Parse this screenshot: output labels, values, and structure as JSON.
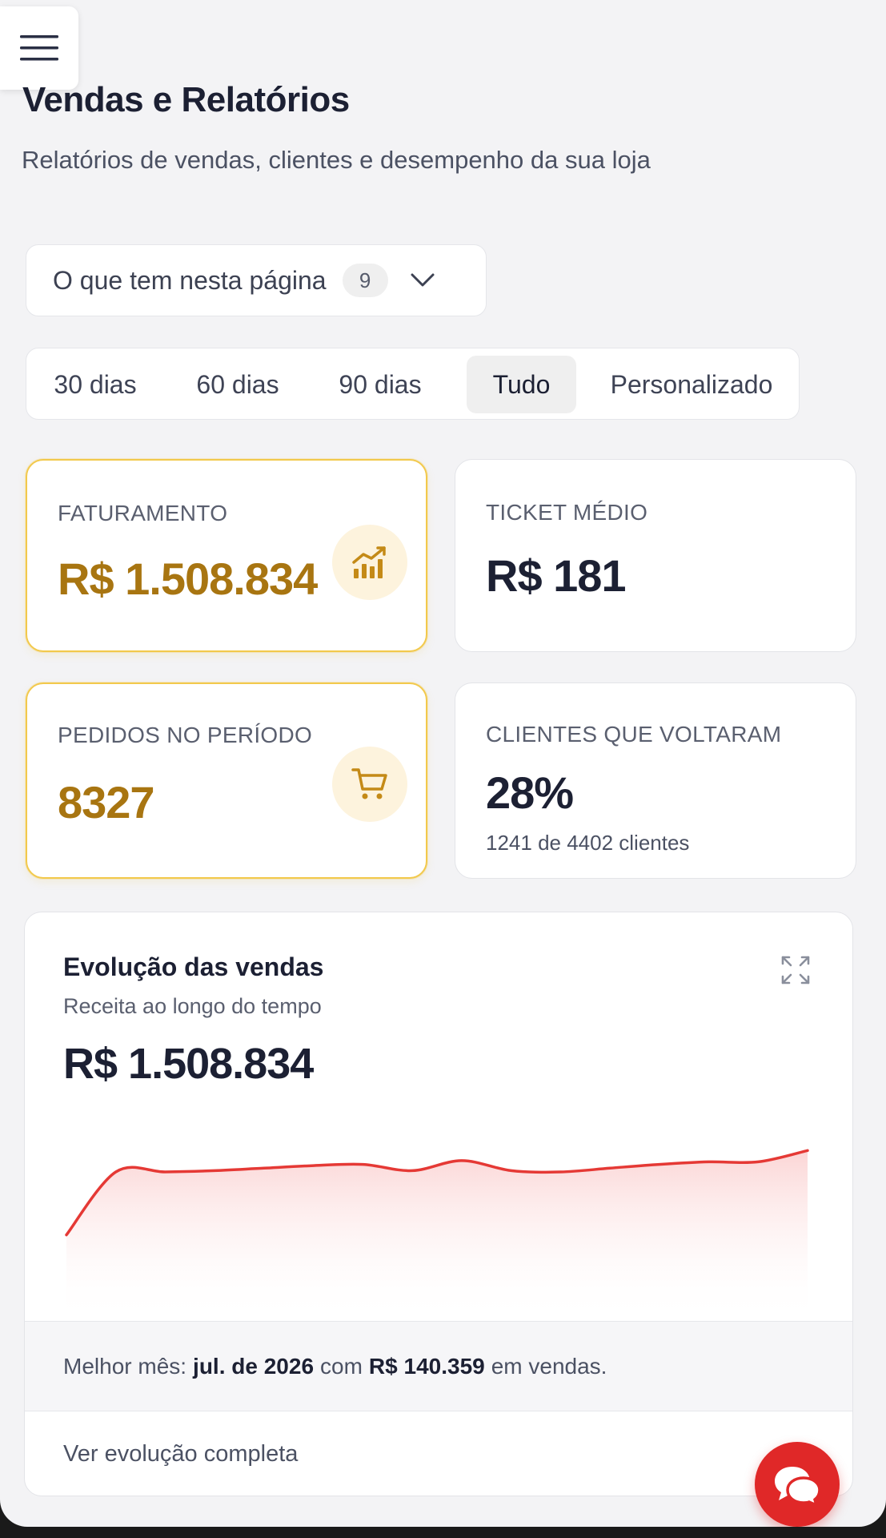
{
  "header": {
    "title": "Vendas e Relatórios",
    "subtitle": "Relatórios de vendas, clientes e desempenho da sua loja",
    "menu_icon": "hamburger-menu-icon"
  },
  "toc": {
    "label": "O que tem nesta página",
    "count": "9",
    "icon": "chevron-down-icon"
  },
  "range_tabs": [
    {
      "label": "30 dias",
      "active": false
    },
    {
      "label": "60 dias",
      "active": false
    },
    {
      "label": "90 dias",
      "active": false
    },
    {
      "label": "Tudo",
      "active": true
    },
    {
      "label": "Personalizado",
      "active": false
    }
  ],
  "metrics": {
    "revenue": {
      "label": "FATURAMENTO",
      "value": "R$ 1.508.834",
      "icon": "bar-chart-trend-icon"
    },
    "ticket": {
      "label": "TICKET MÉDIO",
      "value": "R$ 181"
    },
    "orders": {
      "label": "PEDIDOS NO PERÍODO",
      "value": "8327",
      "icon": "shopping-cart-icon"
    },
    "returning": {
      "label": "CLIENTES QUE VOLTARAM",
      "value": "28%",
      "sub": "1241 de 4402 clientes"
    }
  },
  "sales_chart": {
    "title": "Evolução das vendas",
    "subtitle": "Receita ao longo do tempo",
    "total": "R$ 1.508.834",
    "expand_icon": "expand-icon",
    "best_prefix": "Melhor mês:",
    "best_month": "jul. de 2026",
    "best_mid": "com",
    "best_value": "R$ 140.359",
    "best_suffix": "em vendas.",
    "link": "Ver evolução completa"
  },
  "chart_data": {
    "type": "area",
    "title": "Evolução das vendas",
    "values": [
      62,
      112,
      112,
      113,
      115,
      117,
      118,
      113,
      121,
      113,
      112,
      115,
      118,
      120,
      120,
      129
    ],
    "ylim": [
      0,
      140
    ],
    "line_color": "#e53935",
    "fill_color": "#fde2e2",
    "grid": false
  },
  "chat_fab": {
    "icon": "chat-bubbles-icon"
  },
  "colors": {
    "accent_gold": "#a87511",
    "highlight_border": "#f2c94c",
    "fab_red": "#e02828"
  }
}
